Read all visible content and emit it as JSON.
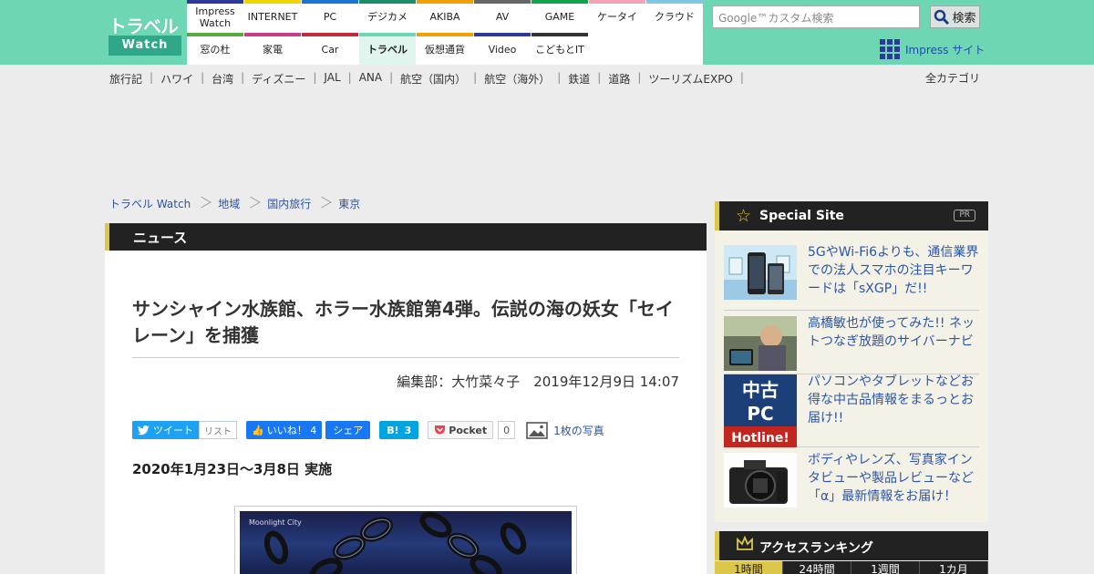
{
  "header": {
    "logo_top": "トラベル",
    "logo_bottom": "Watch",
    "search_placeholder": "Google™カスタム検索",
    "search_button": "検索",
    "impress_sites": "Impress サイト"
  },
  "sitenav": [
    {
      "label": "Impress\nWatch",
      "color": "#2d3a9c"
    },
    {
      "label": "INTERNET",
      "color": "#f0d400"
    },
    {
      "label": "PC",
      "color": "#1976d2"
    },
    {
      "label": "デジカメ",
      "color": "#1b8c6a"
    },
    {
      "label": "AKIBA",
      "color": "#f0a000"
    },
    {
      "label": "AV",
      "color": "#666666"
    },
    {
      "label": "GAME",
      "color": "#10a44c"
    },
    {
      "label": "ケータイ",
      "color": "#f5a3b4"
    },
    {
      "label": "クラウド",
      "color": "#7fc7e8"
    },
    {
      "label": "窓の杜",
      "color": "#5aa83a"
    },
    {
      "label": "家電",
      "color": "#c83c8c"
    },
    {
      "label": "Car",
      "color": "#c8283c"
    },
    {
      "label": "トラベル",
      "color": "#6dd7b4"
    },
    {
      "label": "仮想通貨",
      "color": "#f0a000"
    },
    {
      "label": "Video",
      "color": "#2d3a9c"
    },
    {
      "label": "こどもとIT",
      "color": "#333333"
    }
  ],
  "catnav": [
    "旅行記",
    "ハワイ",
    "台湾",
    "ディズニー",
    "JAL",
    "ANA",
    "航空（国内）",
    "航空（海外）",
    "鉄道",
    "道路",
    "ツーリズムEXPO"
  ],
  "all_categories": "全カテゴリ",
  "breadcrumb": [
    "トラベル Watch",
    "地域",
    "国内旅行",
    "東京"
  ],
  "section_title": "ニュース",
  "article": {
    "headline": "サンシャイン水族館、ホラー水族館第4弾。伝説の海の妖女「セイレーン」を捕獲",
    "byline": "編集部：大竹菜々子　2019年12月9日 14:07",
    "subhead": "2020年1月23日～3月8日 実施",
    "photo_caption": "Moonlight City"
  },
  "share": {
    "tweet": "ツイート",
    "list": "リスト",
    "like": "いいね！ 4",
    "share": "シェア",
    "hatena_count": "3",
    "pocket": "Pocket",
    "pocket_count": "0",
    "photos": "1枚の写真"
  },
  "special": {
    "title": "Special Site",
    "pr": "PR",
    "items": [
      {
        "text": "5GやWi-Fi6よりも、通信業界での法人スマホの注目キーワードは「sXGP」だ!!"
      },
      {
        "text": "高橋敏也が使ってみた!! ネットつなぎ放題のサイバーナビ"
      },
      {
        "text": "パソコンやタブレットなどお得な中古品情報をまるっとお届け!!"
      },
      {
        "text": "ボディやレンズ、写真家インタビューや製品レビューなど「α」最新情報をお届け！"
      }
    ]
  },
  "ranking": {
    "title": "アクセスランキング",
    "tabs": [
      "1時間",
      "24時間",
      "1週間",
      "1カ月"
    ]
  }
}
